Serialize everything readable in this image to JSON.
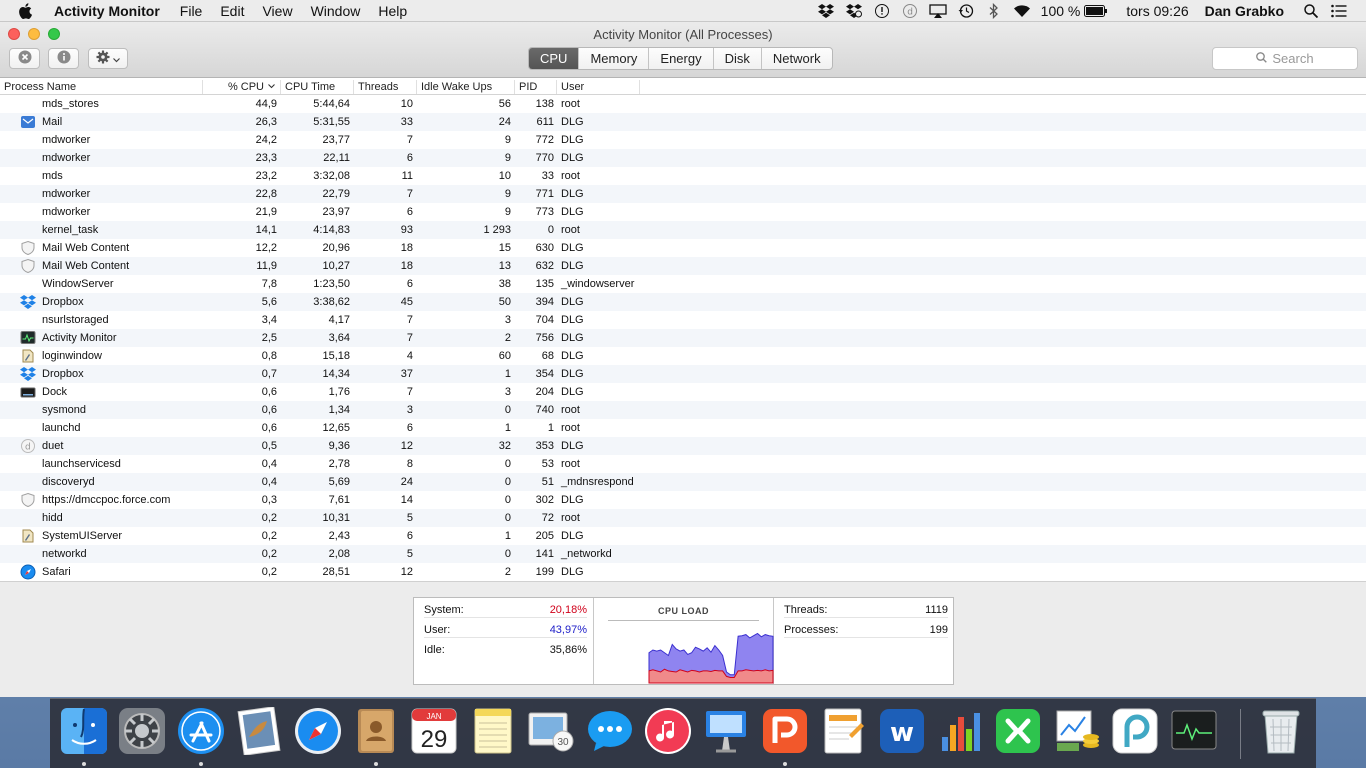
{
  "menubar": {
    "app_name": "Activity Monitor",
    "menus": [
      "File",
      "Edit",
      "View",
      "Window",
      "Help"
    ],
    "battery": "100 %",
    "clock": "tors 09:26",
    "user": "Dan Grabko"
  },
  "window": {
    "title": "Activity Monitor (All Processes)",
    "tabs": [
      "CPU",
      "Memory",
      "Energy",
      "Disk",
      "Network"
    ],
    "active_tab": "CPU",
    "search_placeholder": "Search"
  },
  "table": {
    "headers": {
      "name": "Process Name",
      "cpu": "% CPU",
      "time": "CPU Time",
      "threads": "Threads",
      "idle": "Idle Wake Ups",
      "pid": "PID",
      "user": "User"
    },
    "rows": [
      {
        "name": "mds_stores",
        "cpu": "44,9",
        "time": "5:44,64",
        "threads": "10",
        "idle": "56",
        "pid": "138",
        "user": "root",
        "icon": "none"
      },
      {
        "name": "Mail",
        "cpu": "26,3",
        "time": "5:31,55",
        "threads": "33",
        "idle": "24",
        "pid": "611",
        "user": "DLG",
        "icon": "mail"
      },
      {
        "name": "mdworker",
        "cpu": "24,2",
        "time": "23,77",
        "threads": "7",
        "idle": "9",
        "pid": "772",
        "user": "DLG",
        "icon": "none"
      },
      {
        "name": "mdworker",
        "cpu": "23,3",
        "time": "22,11",
        "threads": "6",
        "idle": "9",
        "pid": "770",
        "user": "DLG",
        "icon": "none"
      },
      {
        "name": "mds",
        "cpu": "23,2",
        "time": "3:32,08",
        "threads": "11",
        "idle": "10",
        "pid": "33",
        "user": "root",
        "icon": "none"
      },
      {
        "name": "mdworker",
        "cpu": "22,8",
        "time": "22,79",
        "threads": "7",
        "idle": "9",
        "pid": "771",
        "user": "DLG",
        "icon": "none"
      },
      {
        "name": "mdworker",
        "cpu": "21,9",
        "time": "23,97",
        "threads": "6",
        "idle": "9",
        "pid": "773",
        "user": "DLG",
        "icon": "none"
      },
      {
        "name": "kernel_task",
        "cpu": "14,1",
        "time": "4:14,83",
        "threads": "93",
        "idle": "1 293",
        "pid": "0",
        "user": "root",
        "icon": "none"
      },
      {
        "name": "Mail Web Content",
        "cpu": "12,2",
        "time": "20,96",
        "threads": "18",
        "idle": "15",
        "pid": "630",
        "user": "DLG",
        "icon": "shield"
      },
      {
        "name": "Mail Web Content",
        "cpu": "11,9",
        "time": "10,27",
        "threads": "18",
        "idle": "13",
        "pid": "632",
        "user": "DLG",
        "icon": "shield"
      },
      {
        "name": "WindowServer",
        "cpu": "7,8",
        "time": "1:23,50",
        "threads": "6",
        "idle": "38",
        "pid": "135",
        "user": "_windowserver",
        "icon": "none"
      },
      {
        "name": "Dropbox",
        "cpu": "5,6",
        "time": "3:38,62",
        "threads": "45",
        "idle": "50",
        "pid": "394",
        "user": "DLG",
        "icon": "dropbox"
      },
      {
        "name": "nsurlstoraged",
        "cpu": "3,4",
        "time": "4,17",
        "threads": "7",
        "idle": "3",
        "pid": "704",
        "user": "DLG",
        "icon": "none"
      },
      {
        "name": "Activity Monitor",
        "cpu": "2,5",
        "time": "3,64",
        "threads": "7",
        "idle": "2",
        "pid": "756",
        "user": "DLG",
        "icon": "activity"
      },
      {
        "name": "loginwindow",
        "cpu": "0,8",
        "time": "15,18",
        "threads": "4",
        "idle": "60",
        "pid": "68",
        "user": "DLG",
        "icon": "login"
      },
      {
        "name": "Dropbox",
        "cpu": "0,7",
        "time": "14,34",
        "threads": "37",
        "idle": "1",
        "pid": "354",
        "user": "DLG",
        "icon": "dropbox"
      },
      {
        "name": "Dock",
        "cpu": "0,6",
        "time": "1,76",
        "threads": "7",
        "idle": "3",
        "pid": "204",
        "user": "DLG",
        "icon": "dock"
      },
      {
        "name": "sysmond",
        "cpu": "0,6",
        "time": "1,34",
        "threads": "3",
        "idle": "0",
        "pid": "740",
        "user": "root",
        "icon": "none"
      },
      {
        "name": "launchd",
        "cpu": "0,6",
        "time": "12,65",
        "threads": "6",
        "idle": "1",
        "pid": "1",
        "user": "root",
        "icon": "none"
      },
      {
        "name": "duet",
        "cpu": "0,5",
        "time": "9,36",
        "threads": "12",
        "idle": "32",
        "pid": "353",
        "user": "DLG",
        "icon": "duet"
      },
      {
        "name": "launchservicesd",
        "cpu": "0,4",
        "time": "2,78",
        "threads": "8",
        "idle": "0",
        "pid": "53",
        "user": "root",
        "icon": "none"
      },
      {
        "name": "discoveryd",
        "cpu": "0,4",
        "time": "5,69",
        "threads": "24",
        "idle": "0",
        "pid": "51",
        "user": "_mdnsrespond",
        "icon": "none"
      },
      {
        "name": "https://dmccpoc.force.com",
        "cpu": "0,3",
        "time": "7,61",
        "threads": "14",
        "idle": "0",
        "pid": "302",
        "user": "DLG",
        "icon": "shield"
      },
      {
        "name": "hidd",
        "cpu": "0,2",
        "time": "10,31",
        "threads": "5",
        "idle": "0",
        "pid": "72",
        "user": "root",
        "icon": "none"
      },
      {
        "name": "SystemUIServer",
        "cpu": "0,2",
        "time": "2,43",
        "threads": "6",
        "idle": "1",
        "pid": "205",
        "user": "DLG",
        "icon": "login"
      },
      {
        "name": "networkd",
        "cpu": "0,2",
        "time": "2,08",
        "threads": "5",
        "idle": "0",
        "pid": "141",
        "user": "_networkd",
        "icon": "none"
      },
      {
        "name": "Safari",
        "cpu": "0,2",
        "time": "28,51",
        "threads": "12",
        "idle": "2",
        "pid": "199",
        "user": "DLG",
        "icon": "safari"
      }
    ]
  },
  "stats": {
    "system_label": "System:",
    "system_value": "20,18%",
    "user_label": "User:",
    "user_value": "43,97%",
    "idle_label": "Idle:",
    "idle_value": "35,86%",
    "cpu_load_title": "CPU LOAD",
    "threads_label": "Threads:",
    "threads_value": "1119",
    "processes_label": "Processes:",
    "processes_value": "199",
    "system_color": "#d0021b",
    "user_color": "#2020c8"
  },
  "cpu_load": {
    "system": [
      0.22,
      0.24,
      0.22,
      0.2,
      0.25,
      0.22,
      0.21,
      0.2,
      0.24,
      0.22,
      0.2,
      0.23,
      0.22,
      0.2,
      0.22,
      0.22,
      0.21,
      0.23,
      0.22,
      0.22,
      0.12,
      0.1,
      0.1,
      0.22,
      0.22,
      0.24,
      0.23,
      0.22,
      0.23,
      0.22,
      0.24,
      0.22,
      0.23
    ],
    "total": [
      0.55,
      0.6,
      0.58,
      0.6,
      0.55,
      0.5,
      0.7,
      0.62,
      0.58,
      0.6,
      0.52,
      0.55,
      0.65,
      0.62,
      0.58,
      0.64,
      0.56,
      0.68,
      0.6,
      0.5,
      0.2,
      0.15,
      0.15,
      0.85,
      0.86,
      0.88,
      0.82,
      0.86,
      0.9,
      0.84,
      0.88,
      0.86,
      0.85
    ]
  },
  "dock": {
    "apps": [
      "Finder",
      "System Preferences",
      "App Store",
      "Preview",
      "Safari",
      "Contacts",
      "Calendar",
      "Notes",
      "Photos",
      "Messages",
      "iTunes",
      "Keynote",
      "WPS Presentation",
      "Pages",
      "Wunderlist",
      "Numbers",
      "Keynote Green",
      "Money",
      "Periscope",
      "Activity Monitor"
    ],
    "calendar_month": "JAN",
    "calendar_day": "29",
    "running": [
      0,
      2,
      5,
      12
    ]
  }
}
